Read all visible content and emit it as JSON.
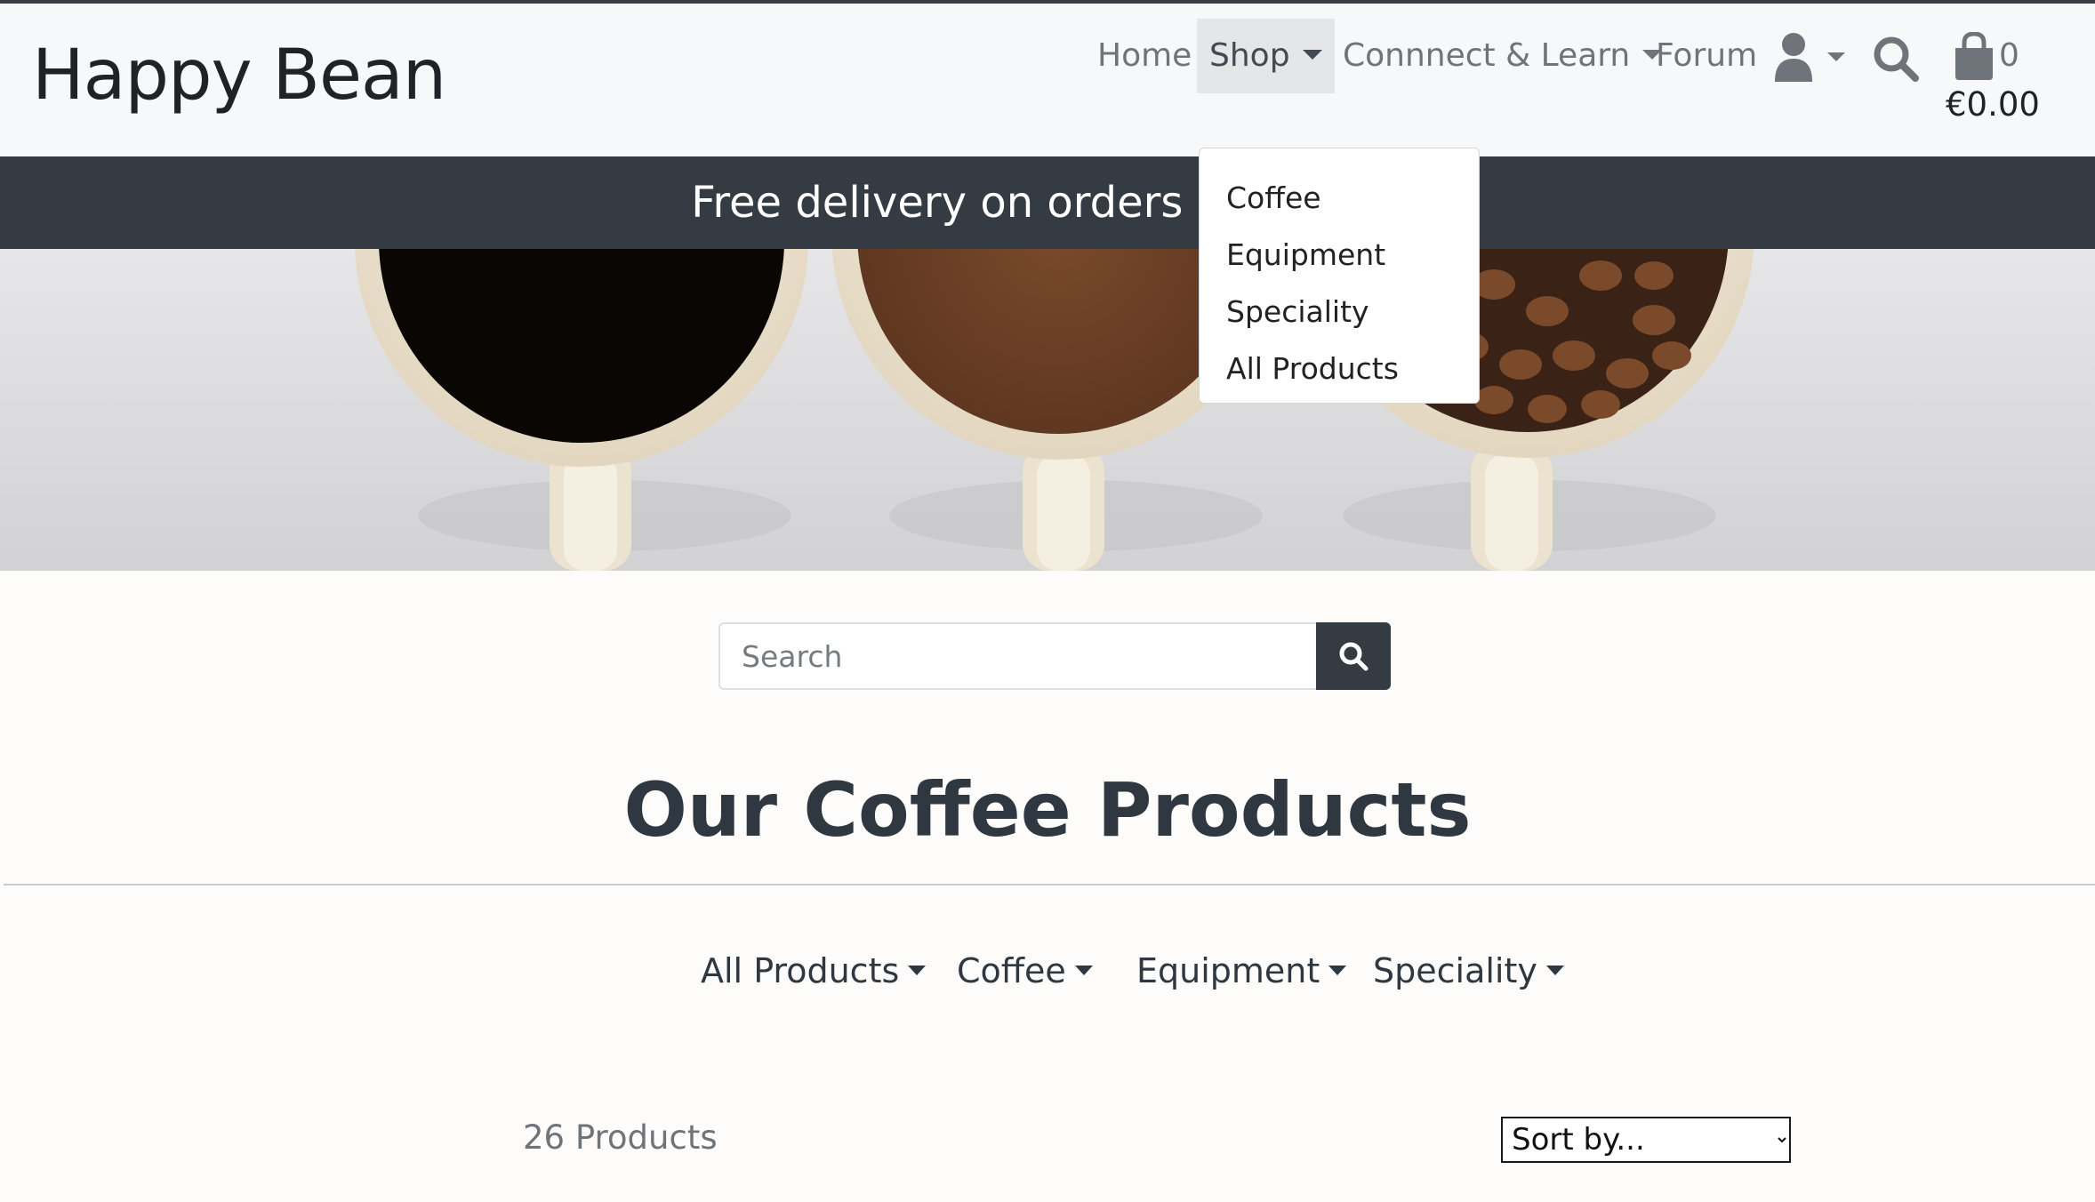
{
  "brand": {
    "name": "Happy Bean"
  },
  "nav": {
    "home": "Home",
    "shop": "Shop",
    "connect": "Connnect & Learn",
    "forum": "Forum"
  },
  "icons": {
    "account": "user-icon",
    "search": "search-icon",
    "bag": "shopping-bag-icon"
  },
  "bag": {
    "count": "0",
    "total": "€0.00"
  },
  "shop_dropdown": {
    "items": [
      "Coffee",
      "Equipment",
      "Speciality",
      "All Products"
    ]
  },
  "banner": {
    "text": "Free delivery on orders over €50!"
  },
  "search": {
    "placeholder": "Search"
  },
  "page": {
    "title": "Our Coffee Products"
  },
  "categories": [
    "All Products",
    "Coffee",
    "Equipment",
    "Speciality"
  ],
  "products": {
    "count_label": "26 Products"
  },
  "sort": {
    "selected": "Sort by..."
  },
  "colors": {
    "dark": "#353b42",
    "header_bg": "#f7f8f9",
    "page_bg": "#fdfcfa"
  }
}
